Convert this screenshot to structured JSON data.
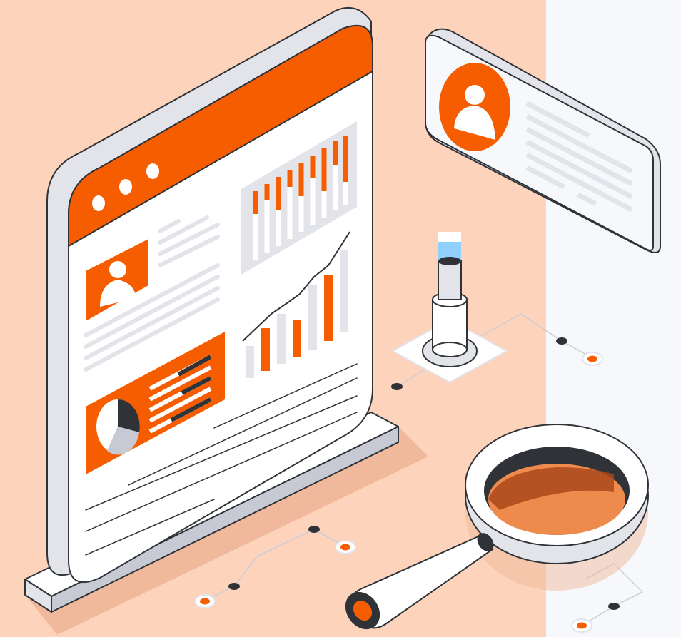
{
  "colors": {
    "peach_background": "#fdd3bb",
    "right_panel_background": "#f7f8fc",
    "accent_orange": "#f65d00",
    "outline_dark": "#2f3338",
    "surface_white": "#ffffff",
    "surface_gray": "#e2e4ea",
    "surface_gray_dark": "#c7cad4",
    "shadow_peach": "#f0b99c",
    "light_blue": "#8fd0ff",
    "lens_orange": "#ef8a4d",
    "lens_dark_orange": "#a9481b"
  },
  "icons": [
    "browser-dots-icon",
    "user-avatar-icon",
    "pie-chart-icon",
    "bar-chart-icon",
    "line-chart-icon",
    "profile-card-icon",
    "magnifying-glass-icon",
    "light-beacon-icon",
    "connector-node-icon"
  ]
}
